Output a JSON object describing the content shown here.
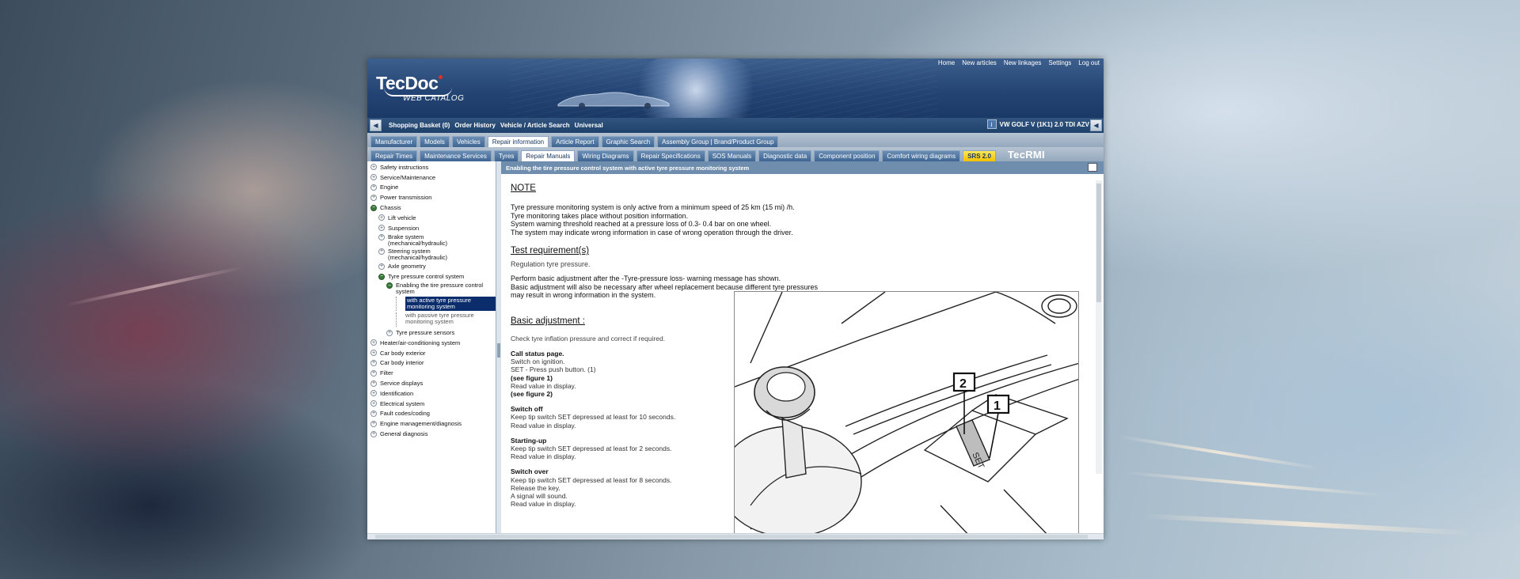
{
  "app": {
    "logo_main": "TecDoc",
    "logo_sub": "WEB CATALOG",
    "top_links": [
      "Home",
      "New articles",
      "New linkages",
      "Settings",
      "Log out"
    ]
  },
  "nav_bar": {
    "links": [
      "Shopping Basket (0)",
      "Order History",
      "Vehicle / Article Search",
      "Universal"
    ],
    "vehicle": "VW GOLF V (1K1) 2.0 TDI AZV"
  },
  "tabs_row1": [
    "Manufacturer",
    "Models",
    "Vehicles",
    "Repair information",
    "Article Report",
    "Graphic Search",
    "Assembly Group | Brand/Product Group"
  ],
  "tabs_row1_active": "Repair information",
  "tabs_row2": [
    "Repair Times",
    "Maintenance Services",
    "Tyres",
    "Repair Manuals",
    "Wiring Diagrams",
    "Repair Specifications",
    "SOS Manuals",
    "Diagnostic data",
    "Component position",
    "Comfort wiring diagrams",
    "SRS 2.0"
  ],
  "tabs_row2_active": "Repair Manuals",
  "tabs_row2_brand": "TecRMI",
  "tree": [
    {
      "label": "Safety instructions",
      "level": 0,
      "open": false
    },
    {
      "label": "Service/Maintenance",
      "level": 0,
      "open": false
    },
    {
      "label": "Engine",
      "level": 0,
      "open": false
    },
    {
      "label": "Power transmission",
      "level": 0,
      "open": false
    },
    {
      "label": "Chassis",
      "level": 0,
      "open": true
    },
    {
      "label": "Lift vehicle",
      "level": 1,
      "open": false
    },
    {
      "label": "Suspension",
      "level": 1,
      "open": false
    },
    {
      "label": "Brake system (mechanical/hydraulic)",
      "level": 1,
      "open": false
    },
    {
      "label": "Steering system (mechanical/hydraulic)",
      "level": 1,
      "open": false
    },
    {
      "label": "Axle geometry",
      "level": 1,
      "open": false
    },
    {
      "label": "Tyre pressure control system",
      "level": 1,
      "open": true
    },
    {
      "label": "Enabling the tire pressure control system",
      "level": 2,
      "open": true
    },
    {
      "label": "with active tyre pressure monitoring system",
      "level": 3,
      "selected": true
    },
    {
      "label": "with passive tyre pressure monitoring system",
      "level": 3,
      "muted": true
    },
    {
      "label": "Tyre pressure sensors",
      "level": 2,
      "open": false
    },
    {
      "label": "Heater/air-conditioning system",
      "level": 0,
      "open": false
    },
    {
      "label": "Car body exterior",
      "level": 0,
      "open": false
    },
    {
      "label": "Car body interior",
      "level": 0,
      "open": false
    },
    {
      "label": "Filter",
      "level": 0,
      "open": false
    },
    {
      "label": "Service displays",
      "level": 0,
      "open": false
    },
    {
      "label": "Identification",
      "level": 0,
      "open": false
    },
    {
      "label": "Electrical system",
      "level": 0,
      "open": false
    },
    {
      "label": "Fault codes/coding",
      "level": 0,
      "open": false
    },
    {
      "label": "Engine management/diagnosis",
      "level": 0,
      "open": false
    },
    {
      "label": "General diagnosis",
      "level": 0,
      "open": false
    }
  ],
  "doc": {
    "title": "Enabling the tire pressure control system with active tyre pressure monitoring system",
    "note_heading": "NOTE",
    "note_lines": [
      "Tyre pressure monitoring system is only active from a minimum speed of 25 km (15 mi) /h.",
      "Tyre monitoring takes place without position information.",
      "System warning threshold reached at a pressure loss of 0.3- 0.4 bar on one wheel.",
      "The system may indicate wrong information in case of wrong operation through the driver."
    ],
    "test_heading": "Test requirement(s)",
    "test_text": "Regulation tyre pressure.",
    "perform_lines": [
      "Perform basic adjustment after the -Tyre-pressure loss- warning message has shown.",
      "Basic adjustment will also be necessary after wheel replacement because different tyre pressures",
      "may result in wrong information in the system."
    ],
    "basic_heading": "Basic adjustment",
    "basic_colon": " :",
    "check_text": "Check tyre inflation pressure and correct if required.",
    "steps": [
      {
        "head": "Call status page.",
        "lines": [
          "Switch on ignition.",
          "SET - Press push button. (1)",
          "(see figure 1)",
          "Read value in display.",
          "(see figure 2)"
        ]
      },
      {
        "head": "Switch off",
        "lines": [
          "Keep tip switch SET depressed at least for 10 seconds.",
          "Read value in display."
        ]
      },
      {
        "head": "Starting-up",
        "lines": [
          "Keep tip switch SET depressed at least for 2 seconds.",
          "Read value in display."
        ]
      },
      {
        "head": "Switch over",
        "lines": [
          "Keep tip switch SET depressed at least for 8 seconds.",
          "Release the key.",
          "A signal will sound.",
          "Read value in display."
        ]
      }
    ],
    "figure_callouts": [
      "1",
      "2"
    ],
    "figure_button_text": "SET"
  },
  "colors": {
    "header_blue": "#244575",
    "tab_blue": "#3e6592",
    "selected_tree": "#0b2d6b",
    "srs_yellow": "#f2c200",
    "doc_title_bar": "#6f8dad"
  }
}
